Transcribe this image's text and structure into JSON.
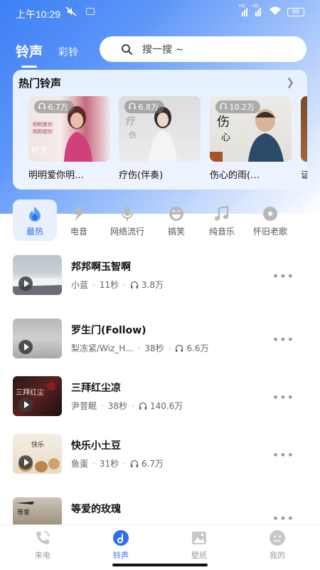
{
  "status": {
    "time": "上午10:29",
    "battery": "89",
    "net1": "HD",
    "net2": "HD"
  },
  "header": {
    "tab_ringtone": "铃声",
    "tab_color_ring": "彩铃",
    "search_placeholder": "搜一搜 ~"
  },
  "hot": {
    "title": "热门铃声",
    "items": [
      {
        "name": "明明爱你明…",
        "count": "6.7万",
        "cover_text": "明明爱你明明想你"
      },
      {
        "name": "疗伤(伴奏)",
        "count": "6.8万",
        "cover_text": "疗伤"
      },
      {
        "name": "伤心的雨(…",
        "count": "10.2万",
        "cover_text": "伤心"
      },
      {
        "name": "证",
        "count": ""
      }
    ]
  },
  "categories": [
    {
      "label": "最热",
      "icon": "fire-icon",
      "active": true
    },
    {
      "label": "电音",
      "icon": "lightning-icon",
      "active": false
    },
    {
      "label": "网络流行",
      "icon": "microphone-icon",
      "active": false
    },
    {
      "label": "搞笑",
      "icon": "laugh-icon",
      "active": false
    },
    {
      "label": "纯音乐",
      "icon": "music-note-icon",
      "active": false
    },
    {
      "label": "怀旧老歌",
      "icon": "vinyl-icon",
      "active": false
    }
  ],
  "songs": [
    {
      "title": "邦邦啊玉智啊",
      "artist": "小蓝",
      "duration": "11秒",
      "plays": "3.8万"
    },
    {
      "title": "罗生门(Follow)",
      "artist": "梨冻紧/Wiz_H...",
      "duration": "38秒",
      "plays": "6.6万"
    },
    {
      "title": "三拜红尘凉",
      "artist": "尹昔眠",
      "duration": "38秒",
      "plays": "140.6万"
    },
    {
      "title": "快乐小土豆",
      "artist": "鱼蛋",
      "duration": "31秒",
      "plays": "6.7万"
    },
    {
      "title": "等爱的玫瑰",
      "artist": "",
      "duration": "",
      "plays": ""
    }
  ],
  "nav": [
    {
      "label": "来电",
      "icon": "phone-icon",
      "active": false
    },
    {
      "label": "铃声",
      "icon": "ringtone-icon",
      "active": true
    },
    {
      "label": "壁纸",
      "icon": "wallpaper-icon",
      "active": false
    },
    {
      "label": "我的",
      "icon": "profile-icon",
      "active": false
    }
  ],
  "colors": {
    "accent": "#2e6ff0",
    "header_blue": "#3d7ff5"
  }
}
